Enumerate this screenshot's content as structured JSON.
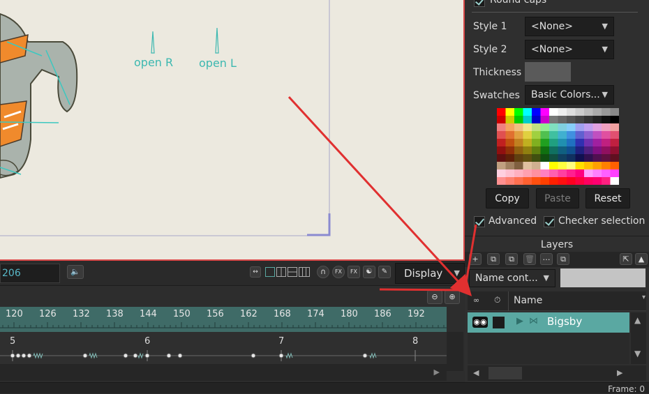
{
  "canvas": {
    "labels": [
      {
        "text": "open R"
      },
      {
        "text": "open L"
      }
    ]
  },
  "playbar": {
    "frame_value": "206",
    "display_label": "Display"
  },
  "timeline": {
    "ruler_ticks": [
      "120",
      "126",
      "132",
      "138",
      "144",
      "150",
      "156",
      "162",
      "168",
      "174",
      "180",
      "186",
      "192"
    ],
    "second_marks": [
      "5",
      "6",
      "7",
      "8"
    ]
  },
  "brush_panel": {
    "round_caps_label": "Round caps",
    "style1_label": "Style 1",
    "style1_value": "<None>",
    "style2_label": "Style 2",
    "style2_value": "<None>",
    "thickness_label": "Thickness",
    "swatches_label": "Swatches",
    "swatches_value": "Basic Colors...",
    "copy_label": "Copy",
    "paste_label": "Paste",
    "reset_label": "Reset",
    "advanced_label": "Advanced",
    "checker_label": "Checker selection"
  },
  "layers_panel": {
    "title": "Layers",
    "filter_value": "Name cont...",
    "column_name": "Name",
    "layers": [
      {
        "name": "Bigsby"
      }
    ]
  },
  "status": {
    "frame_text": "Frame: 0"
  },
  "colors": {
    "accent": "#5aa8a2",
    "annotation_red": "#e03030",
    "canvas_bg": "#ece9df"
  }
}
